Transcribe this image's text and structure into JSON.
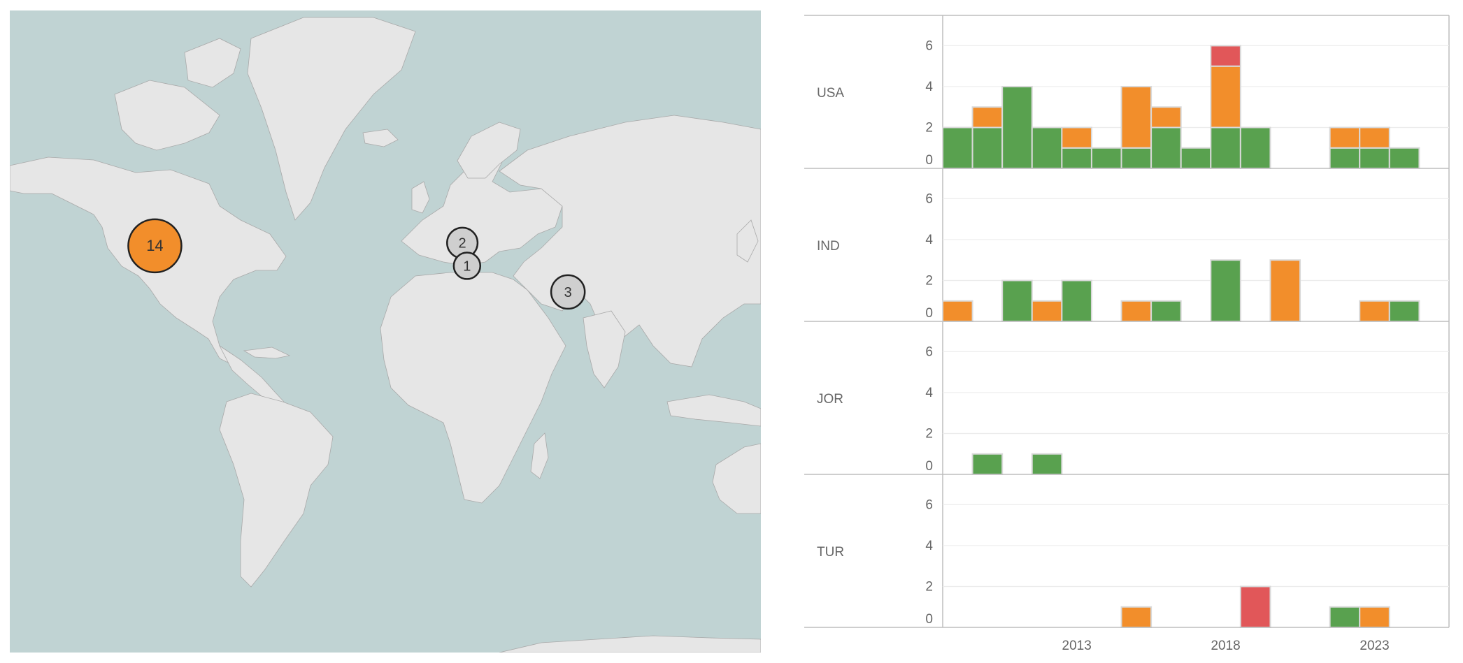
{
  "map": {
    "ocean_color": "#c0d3d3",
    "land_color": "#e6e6e6",
    "border_color": "#a9a9a9",
    "markers": [
      {
        "id": "USA",
        "label": "14",
        "value": 14,
        "color": "#f28e2b",
        "lon": -97,
        "lat": 38
      },
      {
        "id": "TUR",
        "label": "2",
        "value": 2,
        "color": "#cfcfcf",
        "lon": 34,
        "lat": 39
      },
      {
        "id": "JOR",
        "label": "1",
        "value": 1,
        "color": "#cfcfcf",
        "lon": 36,
        "lat": 31
      },
      {
        "id": "IND",
        "label": "3",
        "value": 3,
        "color": "#cfcfcf",
        "lon": 79,
        "lat": 21
      }
    ]
  },
  "colors": {
    "green": "#59a14f",
    "orange": "#f28e2b",
    "red": "#e15759",
    "grid": "#ececec",
    "axis": "#bdbdbd",
    "text": "#666666"
  },
  "chart_data": {
    "type": "bar",
    "stacked": true,
    "x_ticks": [
      "2013",
      "2018",
      "2023"
    ],
    "x_range": [
      2008.5,
      2025.5
    ],
    "ylim": [
      0,
      7
    ],
    "y_ticks": [
      "0",
      "2",
      "4",
      "6"
    ],
    "series_order": [
      "green",
      "orange",
      "red"
    ],
    "panels": [
      {
        "name": "USA",
        "bars": [
          {
            "year": 2009,
            "green": 2,
            "orange": 0,
            "red": 0
          },
          {
            "year": 2010,
            "green": 2,
            "orange": 1,
            "red": 0
          },
          {
            "year": 2011,
            "green": 4,
            "orange": 0,
            "red": 0
          },
          {
            "year": 2012,
            "green": 2,
            "orange": 0,
            "red": 0
          },
          {
            "year": 2013,
            "green": 1,
            "orange": 1,
            "red": 0
          },
          {
            "year": 2014,
            "green": 1,
            "orange": 0,
            "red": 0
          },
          {
            "year": 2015,
            "green": 1,
            "orange": 3,
            "red": 0
          },
          {
            "year": 2016,
            "green": 2,
            "orange": 1,
            "red": 0
          },
          {
            "year": 2017,
            "green": 1,
            "orange": 0,
            "red": 0
          },
          {
            "year": 2018,
            "green": 2,
            "orange": 3,
            "red": 1
          },
          {
            "year": 2019,
            "green": 2,
            "orange": 0,
            "red": 0
          },
          {
            "year": 2022,
            "green": 1,
            "orange": 1,
            "red": 0
          },
          {
            "year": 2023,
            "green": 1,
            "orange": 1,
            "red": 0
          },
          {
            "year": 2024,
            "green": 1,
            "orange": 0,
            "red": 0
          }
        ]
      },
      {
        "name": "IND",
        "bars": [
          {
            "year": 2009,
            "green": 0,
            "orange": 1,
            "red": 0
          },
          {
            "year": 2011,
            "green": 2,
            "orange": 0,
            "red": 0
          },
          {
            "year": 2012,
            "green": 0,
            "orange": 1,
            "red": 0
          },
          {
            "year": 2013,
            "green": 2,
            "orange": 0,
            "red": 0
          },
          {
            "year": 2015,
            "green": 0,
            "orange": 1,
            "red": 0
          },
          {
            "year": 2016,
            "green": 1,
            "orange": 0,
            "red": 0
          },
          {
            "year": 2018,
            "green": 3,
            "orange": 0,
            "red": 0
          },
          {
            "year": 2020,
            "green": 0,
            "orange": 3,
            "red": 0
          },
          {
            "year": 2023,
            "green": 0,
            "orange": 1,
            "red": 0
          },
          {
            "year": 2024,
            "green": 1,
            "orange": 0,
            "red": 0
          }
        ]
      },
      {
        "name": "JOR",
        "bars": [
          {
            "year": 2010,
            "green": 1,
            "orange": 0,
            "red": 0
          },
          {
            "year": 2012,
            "green": 1,
            "orange": 0,
            "red": 0
          }
        ]
      },
      {
        "name": "TUR",
        "bars": [
          {
            "year": 2015,
            "green": 0,
            "orange": 1,
            "red": 0
          },
          {
            "year": 2019,
            "green": 0,
            "orange": 0,
            "red": 2
          },
          {
            "year": 2022,
            "green": 1,
            "orange": 0,
            "red": 0
          },
          {
            "year": 2023,
            "green": 0,
            "orange": 1,
            "red": 0
          }
        ]
      }
    ]
  }
}
